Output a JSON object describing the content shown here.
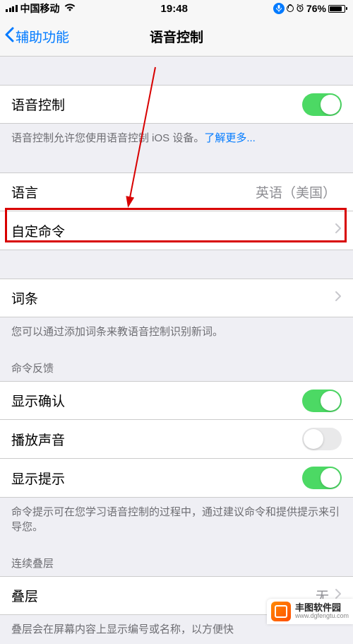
{
  "status": {
    "carrier": "中国移动",
    "time": "19:48",
    "battery_pct": "76%"
  },
  "nav": {
    "back_label": "辅助功能",
    "title": "语音控制"
  },
  "voice_control": {
    "label": "语音控制",
    "on": true,
    "footer": "语音控制允许您使用语音控制 iOS 设备。",
    "link": "了解更多..."
  },
  "language_row": {
    "label": "语言",
    "value": "英语（美国）"
  },
  "custom_commands": {
    "label": "自定命令"
  },
  "vocabulary": {
    "label": "词条",
    "footer": "您可以通过添加词条来教语音控制识别新词。"
  },
  "command_feedback": {
    "header": "命令反馈",
    "show_confirm": {
      "label": "显示确认",
      "on": true
    },
    "play_sound": {
      "label": "播放声音",
      "on": false
    },
    "show_hint": {
      "label": "显示提示",
      "on": true
    },
    "footer": "命令提示可在您学习语音控制的过程中，通过建议命令和提供提示来引导您。"
  },
  "overlay": {
    "header": "连续叠层",
    "label": "叠层",
    "value": "无",
    "footer": "叠层会在屏幕内容上显示编号或名称，以方便快"
  },
  "watermark": {
    "title": "丰图软件园",
    "url": "www.dgfengtu.com"
  }
}
